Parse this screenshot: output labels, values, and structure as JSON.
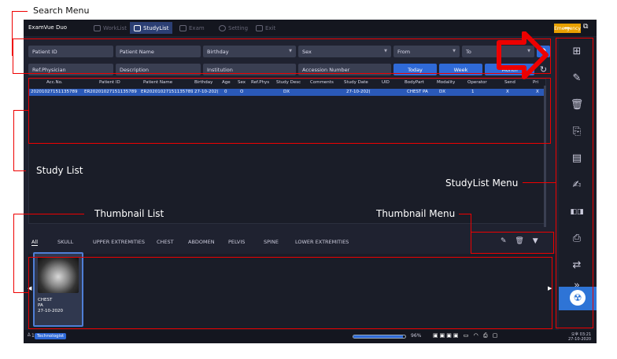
{
  "annotations": {
    "search_menu": "Search Menu",
    "study_list": "Study List",
    "thumbnail_list": "Thumbnail List",
    "thumbnail_menu": "Thumbnail Menu",
    "studylist_menu": "StudyList Menu"
  },
  "app": {
    "name": "ExamVue Duo",
    "tabs": [
      "WorkList",
      "StudyList",
      "Exam",
      "Setting",
      "Exit"
    ],
    "active_tab": "StudyList",
    "emergency_label": "Emergency"
  },
  "search": {
    "row1": [
      {
        "label": "Patient ID",
        "dropdown": false
      },
      {
        "label": "Patient Name",
        "dropdown": false
      },
      {
        "label": "Birthday",
        "dropdown": true
      },
      {
        "label": "Sex",
        "dropdown": true
      },
      {
        "label": "From",
        "dropdown": true
      },
      {
        "label": "To",
        "dropdown": true
      }
    ],
    "row2": [
      {
        "label": "Ref.Physician"
      },
      {
        "label": "Description"
      },
      {
        "label": "Institution"
      },
      {
        "label": "Accession Number"
      }
    ],
    "quick_buttons": [
      "Today",
      "Week",
      "Month"
    ]
  },
  "study_list": {
    "columns": [
      "Acc.No.",
      "Patient ID",
      "Patient Name",
      "Birthday",
      "Age",
      "Sex",
      "Ref.Phys",
      "Study Desc",
      "Comments",
      "Study Date",
      "UID",
      "BodyPart",
      "Modality",
      "Operator",
      "Send",
      "Pri"
    ],
    "rows": [
      [
        "20201027151135789",
        "ER20201027151135789",
        "ER20201027151135789",
        "27-10-202(",
        "0",
        "O",
        "",
        "DX",
        "",
        "27-10-202(",
        "",
        "CHEST PA",
        "DX",
        "1",
        "X",
        "X"
      ]
    ]
  },
  "thumbnail_tabs": [
    "All",
    "SKULL",
    "UPPER EXTREMITIES",
    "CHEST",
    "ABDOMEN",
    "PELVIS",
    "SPINE",
    "LOWER EXTREMITIES"
  ],
  "thumbnail": {
    "line1": "CHEST",
    "line2": "PA",
    "line3": "27-10-2020"
  },
  "status": {
    "user_count": "1",
    "role": "Technologist",
    "progress": 0.96,
    "progress_text": "96%",
    "time": "오후 03:21",
    "date": "27-10-2020"
  },
  "colors": {
    "accent": "#2f6ad8",
    "emergency": "#e8a000",
    "annotation": "#e00000"
  }
}
